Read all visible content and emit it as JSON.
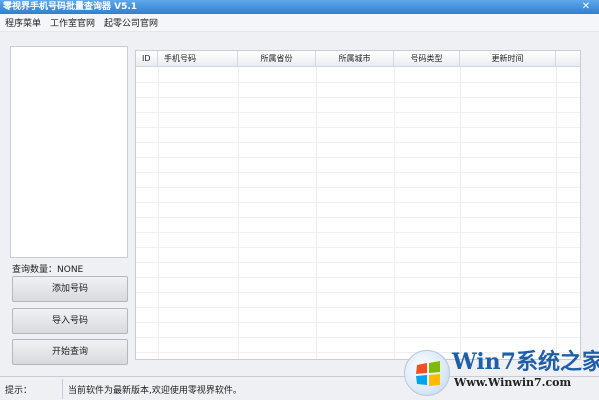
{
  "window": {
    "title": "零视界手机号码批量查询器 V5.1",
    "close_glyph": "✕"
  },
  "menu": {
    "items": [
      {
        "label": "程序菜单"
      },
      {
        "label": "工作室官网"
      },
      {
        "label": "起零公司官网"
      }
    ]
  },
  "sidebar": {
    "query_count": "查询数量：NONE",
    "buttons": [
      {
        "label": "添加号码"
      },
      {
        "label": "导入号码"
      },
      {
        "label": "开始查询"
      }
    ]
  },
  "table": {
    "columns": [
      {
        "label": "ID"
      },
      {
        "label": "手机号码"
      },
      {
        "label": "所属省份"
      },
      {
        "label": "所属城市"
      },
      {
        "label": "号码类型"
      },
      {
        "label": "更新时间"
      }
    ],
    "rows": []
  },
  "statusbar": {
    "label": "提示：",
    "message": "当前软件为最新版本,欢迎使用零视界软件。"
  },
  "watermark": {
    "title": "Win7系统之家",
    "url": "Www.Winwin7.com"
  },
  "colors": {
    "titlebar": "#2f7fd1",
    "background": "#eef0f3",
    "watermark_blue": "#1e5fa8"
  }
}
